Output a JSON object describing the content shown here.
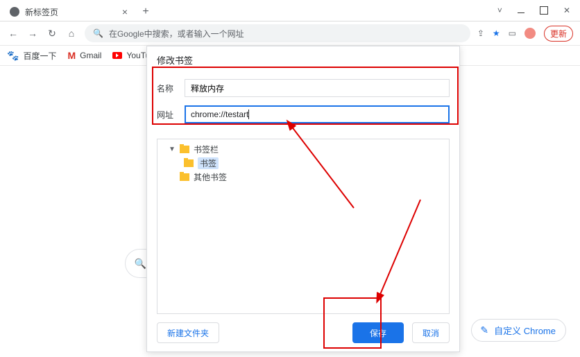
{
  "titlebar": {
    "tab_title": "新标签页"
  },
  "omnibox": {
    "placeholder": "在Google中搜索，或者输入一个网址"
  },
  "toolbar": {
    "update_label": "更新"
  },
  "bookmarks": {
    "baidu": "百度一下",
    "gmail": "Gmail",
    "youtube": "YouTu..."
  },
  "dialog": {
    "title": "修改书签",
    "name_label": "名称",
    "name_value": "释放内存",
    "url_label": "网址",
    "url_value": "chrome://testart",
    "tree": {
      "bookmarks_bar": "书签栏",
      "bookmarks": "书签",
      "other_bookmarks": "其他书签"
    },
    "new_folder_label": "新建文件夹",
    "save_label": "保存",
    "cancel_label": "取消"
  },
  "customize": {
    "label": "自定义 Chrome"
  }
}
